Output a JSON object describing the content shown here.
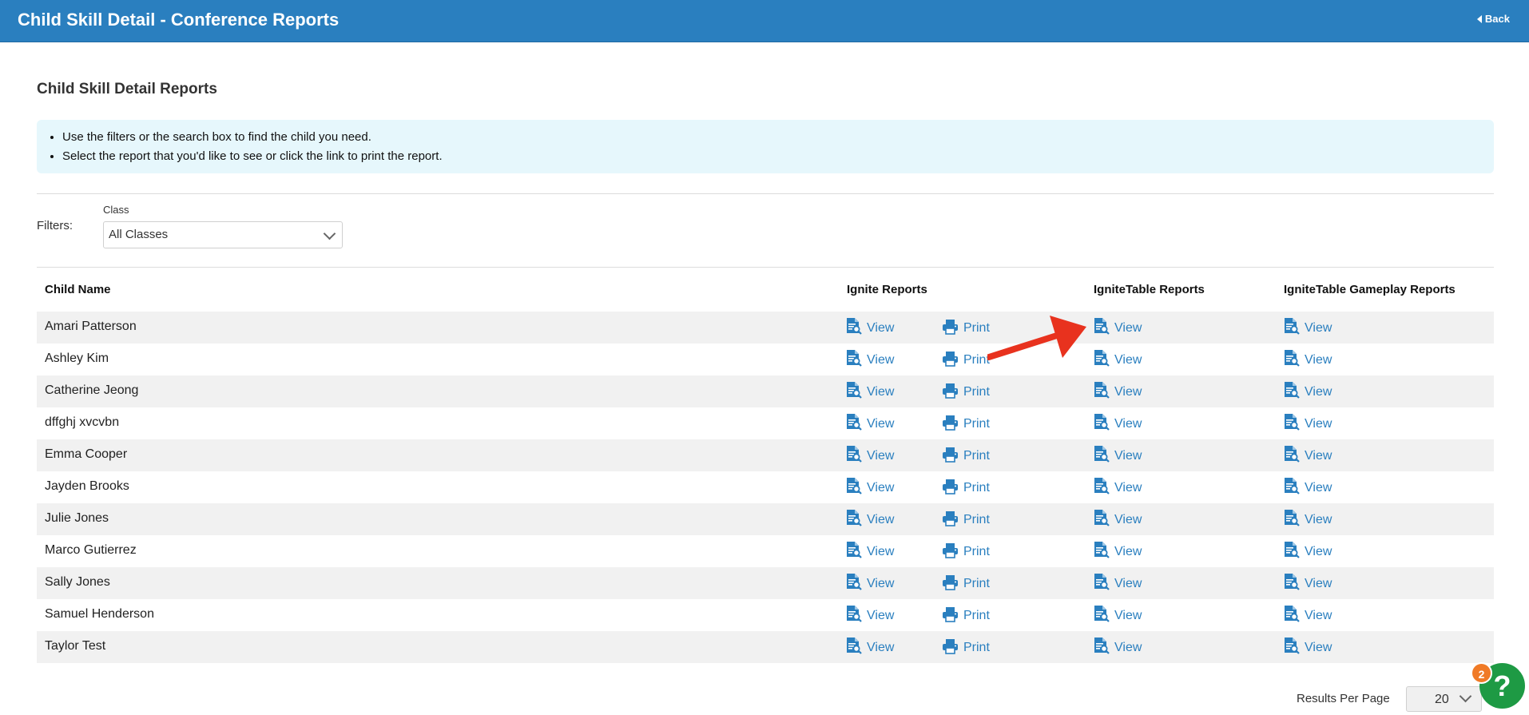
{
  "header": {
    "title": "Child Skill Detail - Conference Reports",
    "back_label": "Back"
  },
  "section_title": "Child Skill Detail Reports",
  "info": {
    "items": [
      "Use the filters or the search box to find the child you need.",
      "Select the report that you'd like to see or click the link to print the report."
    ]
  },
  "filters": {
    "label": "Filters:",
    "class_label": "Class",
    "class_value": "All Classes"
  },
  "table": {
    "columns": {
      "name": "Child Name",
      "ignite": "Ignite Reports",
      "ignitetable": "IgniteTable Reports",
      "gameplay": "IgniteTable Gameplay Reports"
    },
    "view_label": "View",
    "print_label": "Print",
    "rows": [
      {
        "name": "Amari Patterson"
      },
      {
        "name": "Ashley Kim"
      },
      {
        "name": "Catherine Jeong"
      },
      {
        "name": "dffghj xvcvbn"
      },
      {
        "name": "Emma Cooper"
      },
      {
        "name": "Jayden Brooks"
      },
      {
        "name": "Julie Jones"
      },
      {
        "name": "Marco Gutierrez"
      },
      {
        "name": "Sally Jones"
      },
      {
        "name": "Samuel Henderson"
      },
      {
        "name": "Taylor Test"
      }
    ]
  },
  "pagination": {
    "results_label": "Results Per Page",
    "per_page": "20"
  },
  "help": {
    "badge_count": "2",
    "symbol": "?"
  },
  "colors": {
    "header_blue": "#2a7fbf",
    "link_blue": "#2a7fbf",
    "info_bg": "#e6f7fc",
    "arrow_red": "#e8321e",
    "help_green": "#1e9a44",
    "badge_orange": "#f07a26"
  },
  "icons": {
    "view": "document-search-icon",
    "print": "printer-icon",
    "back": "caret-left-icon",
    "annotation": "red-arrow-icon"
  }
}
